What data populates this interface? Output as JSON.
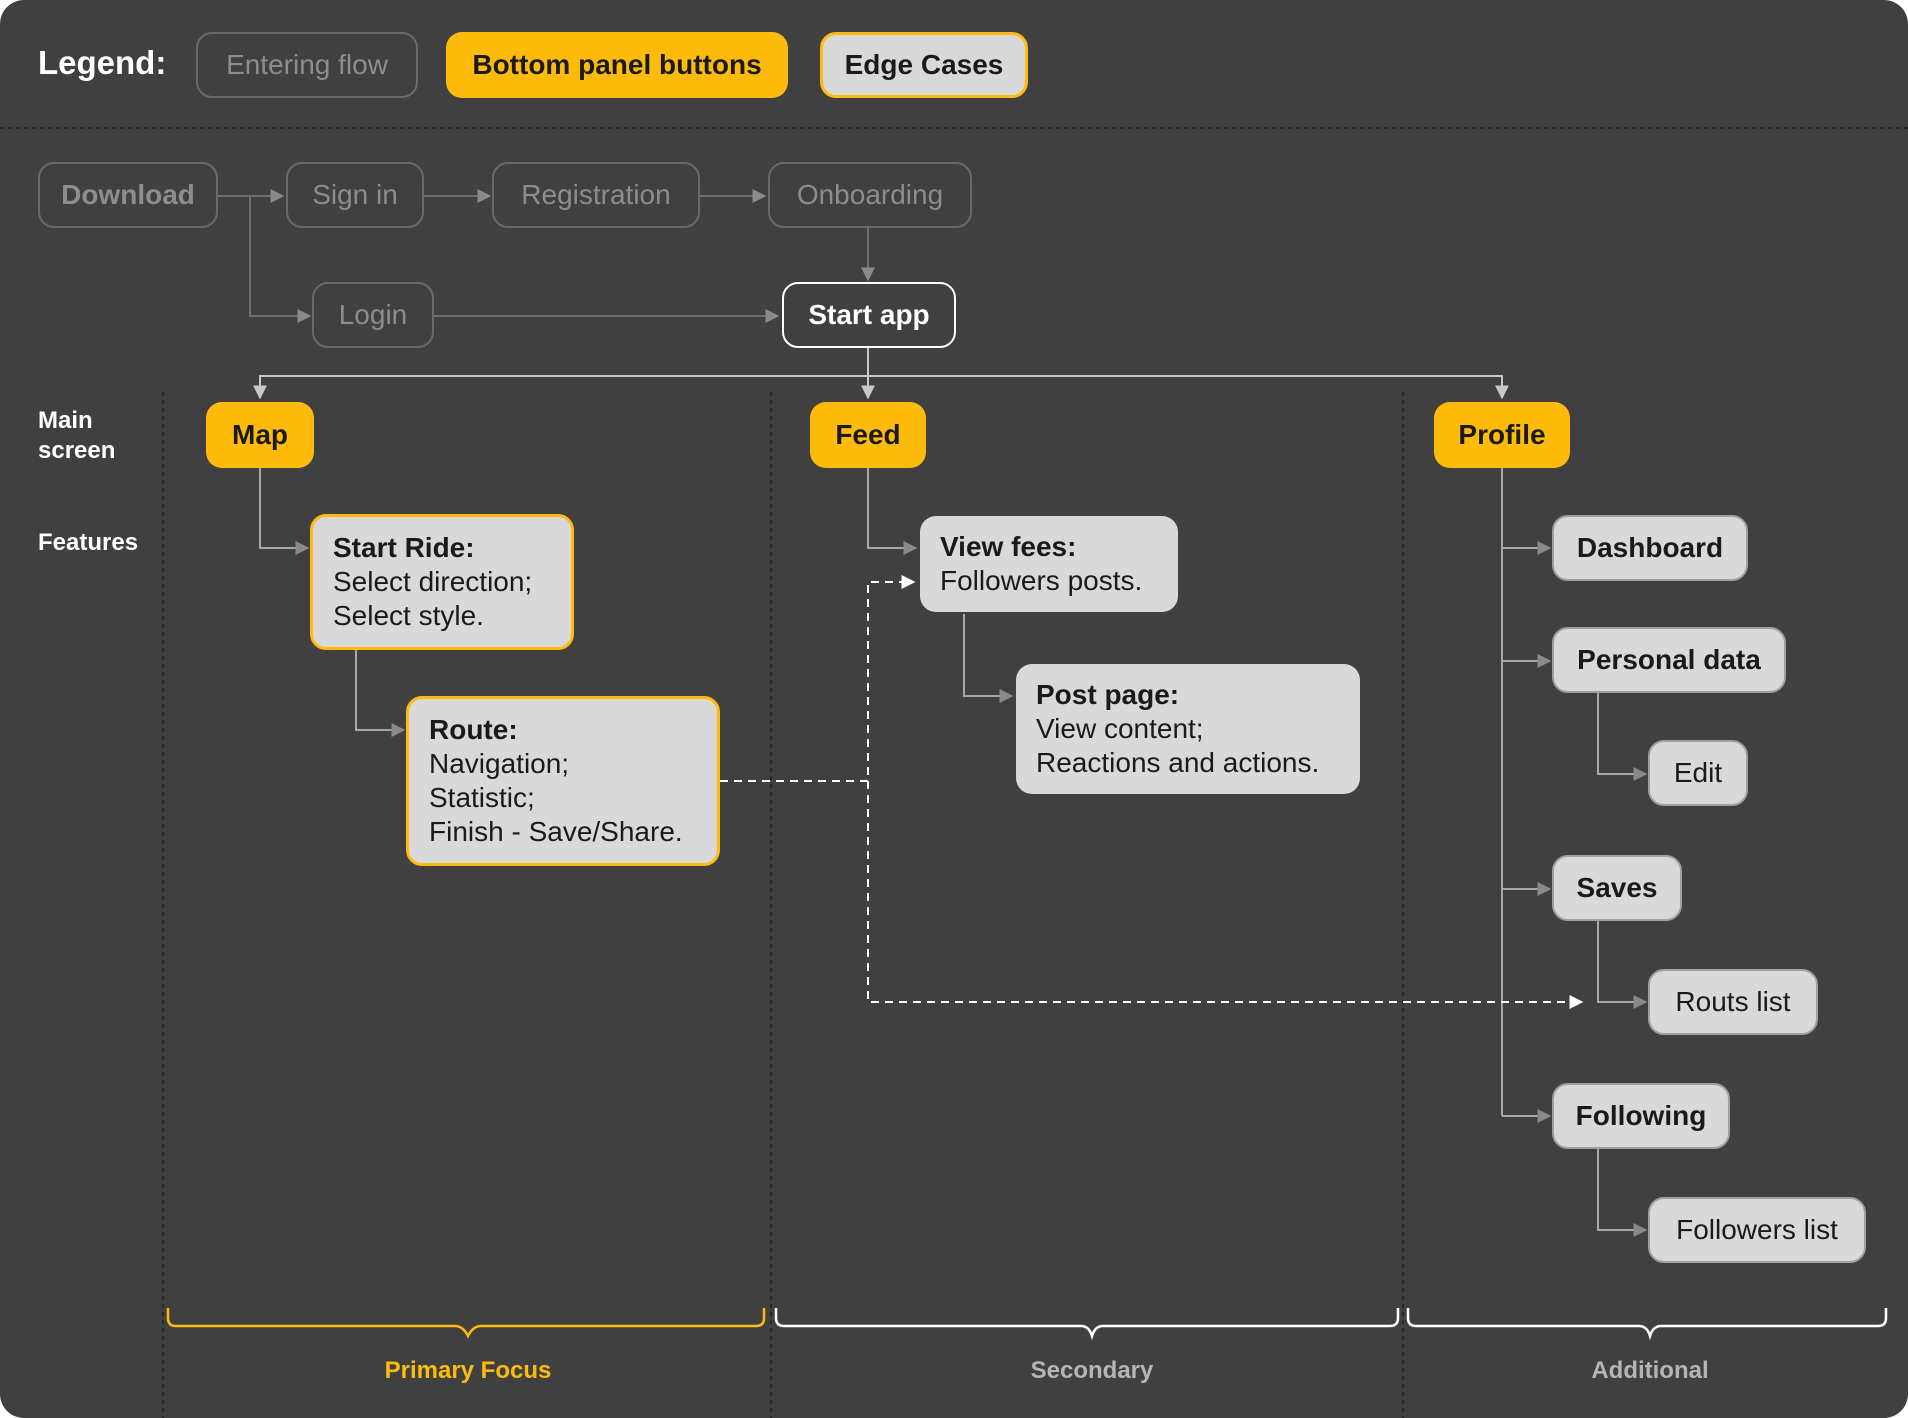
{
  "legend": {
    "title": "Legend:",
    "entering_flow": "Entering flow",
    "bottom_panel": "Bottom panel buttons",
    "edge_cases": "Edge Cases"
  },
  "entry_flow": {
    "download": "Download",
    "sign_in": "Sign in",
    "registration": "Registration",
    "onboarding": "Onboarding",
    "login": "Login",
    "start_app": "Start app"
  },
  "row_labels": {
    "main_screen": "Main\nscreen",
    "features": "Features"
  },
  "main_screens": {
    "map": "Map",
    "feed": "Feed",
    "profile": "Profile"
  },
  "map_features": {
    "start_ride": {
      "title": "Start Ride:",
      "lines": [
        "Select direction;",
        "Select style."
      ]
    },
    "route": {
      "title": "Route:",
      "lines": [
        "Navigation;",
        "Statistic;",
        "Finish - Save/Share."
      ]
    }
  },
  "feed_features": {
    "view_fees": {
      "title": "View fees:",
      "lines": [
        "Followers posts."
      ]
    },
    "post_page": {
      "title": "Post page:",
      "lines": [
        "View content;",
        "Reactions and actions."
      ]
    }
  },
  "profile_features": {
    "dashboard": "Dashboard",
    "personal_data": "Personal data",
    "edit": "Edit",
    "saves": "Saves",
    "routs_list": "Routs list",
    "following": "Following",
    "followers_list": "Followers list"
  },
  "sections": {
    "primary": "Primary Focus",
    "secondary": "Secondary",
    "additional": "Additional"
  },
  "colors": {
    "background": "#404040",
    "accent_yellow": "#ffbb0c",
    "node_grey": "#d9d9d9",
    "entry_muted": "#8d8d8d",
    "section_label_muted": "#b5b5b5"
  }
}
